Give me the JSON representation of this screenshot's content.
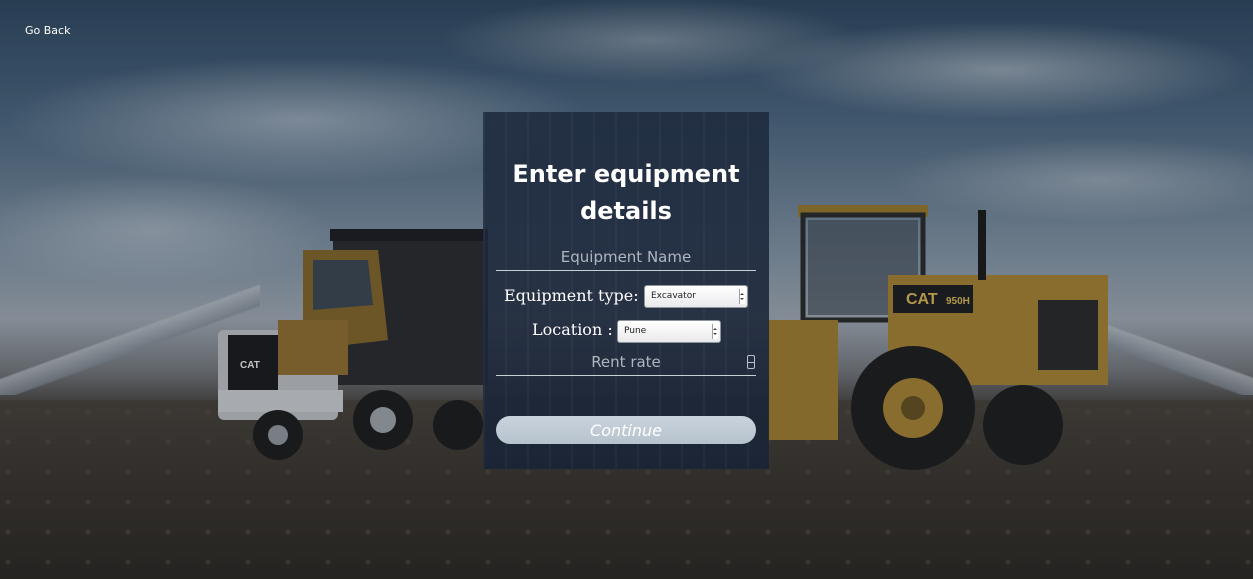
{
  "nav": {
    "go_back_label": "Go Back"
  },
  "form": {
    "title": "Enter equipment details",
    "equipment_name_placeholder": "Equipment Name",
    "equipment_type_label": "Equipment type:",
    "equipment_type_value": "Excavator",
    "location_label": "Location :",
    "location_value": "Pune",
    "rent_rate_placeholder": "Rent rate",
    "continue_label": "Continue"
  },
  "colors": {
    "panel_bg": "#1e2a3e",
    "button_bg": "#c3cdd7",
    "text_primary": "#ffffff"
  },
  "icons": {
    "rent_rate_spinner": "number-spinner-icon",
    "select_arrow": "select-arrows-icon"
  }
}
